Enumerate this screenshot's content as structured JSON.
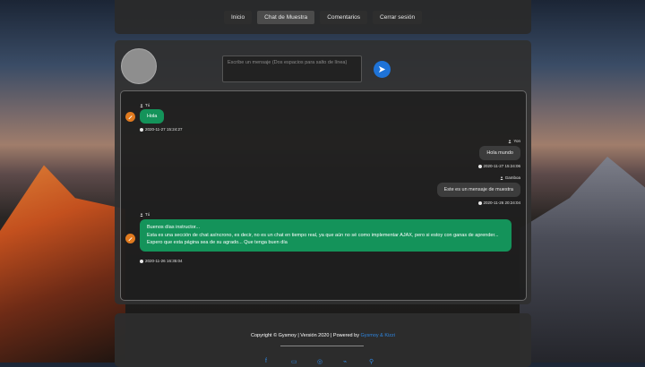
{
  "nav": {
    "items": [
      {
        "label": "Inicio"
      },
      {
        "label": "Chat de Muestra",
        "active": true
      },
      {
        "label": "Comentarios"
      },
      {
        "label": "Cerrar sesión"
      }
    ]
  },
  "composer": {
    "placeholder": "Escribe un mensaje (Dos espacios para salto de línea)"
  },
  "messages": [
    {
      "user": "Tú",
      "text": "Hola",
      "time": "2020-11-27 15:24:27",
      "side": "left"
    },
    {
      "user": "Yon",
      "text": "Hola mundo",
      "time": "2020-11-27 15:24:06",
      "side": "right"
    },
    {
      "user": "Gamboa",
      "text": "Este es un mensaje de muestra",
      "time": "2020-11-26 20:24:04",
      "side": "right"
    },
    {
      "user": "Tú",
      "lines": [
        "Buenos días instructor...",
        "Esta es una sección de chat asíncrono, es decir, no es un chat en tiempo real, ya que aún no sé como implementar AJAX, pero si estoy con ganas de aprender...",
        "Espero que esta página sea de su agrado... Que tenga buen día"
      ],
      "time": "2020-11-26 16:35:04",
      "side": "left"
    }
  ],
  "footer": {
    "text": "Copyright © Gysmoy | Versión 2020 | Powered by",
    "link": "Gysmoy & Kizzi"
  },
  "colors": {
    "accent": "#1e73d8",
    "bubble_own": "#14935a",
    "bubble_other": "#3c3c3c",
    "avatar_badge": "#e07a1f"
  }
}
